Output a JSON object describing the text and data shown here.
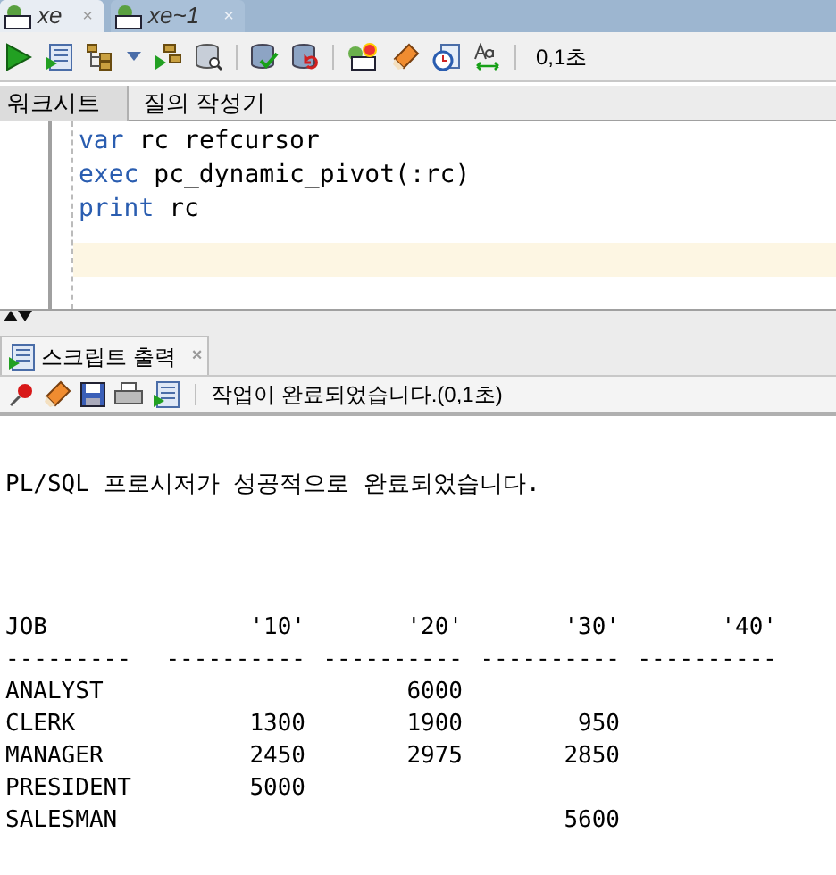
{
  "file_tabs": [
    {
      "label": "xe",
      "selected": true,
      "close": "×"
    },
    {
      "label": "xe~1",
      "selected": false,
      "close": "×"
    }
  ],
  "toolbar": {
    "elapsed": "0,1초"
  },
  "editor_tabs": [
    {
      "label": "워크시트",
      "selected": true
    },
    {
      "label": "질의 작성기",
      "selected": false
    }
  ],
  "code_lines": [
    [
      {
        "kind": "keyword",
        "text": "var"
      },
      {
        "kind": "plain",
        "text": " rc refcursor"
      }
    ],
    [
      {
        "kind": "keyword",
        "text": "exec"
      },
      {
        "kind": "plain",
        "text": " pc_dynamic_pivot(:rc)"
      }
    ],
    [
      {
        "kind": "keyword",
        "text": "print"
      },
      {
        "kind": "plain",
        "text": " rc"
      }
    ]
  ],
  "output_tab": {
    "label": "스크립트 출력",
    "close": "×"
  },
  "output_status": "작업이 완료되었습니다.(0,1초)",
  "output": {
    "message": "PL/SQL 프로시저가 성공적으로 완료되었습니다.",
    "columns": [
      "JOB",
      "'10'",
      "'20'",
      "'30'",
      "'40'"
    ],
    "separators": [
      "---------",
      "----------",
      "----------",
      "----------",
      "----------"
    ],
    "rows": [
      [
        "ANALYST",
        "",
        "6000",
        "",
        ""
      ],
      [
        "CLERK",
        "1300",
        "1900",
        "950",
        ""
      ],
      [
        "MANAGER",
        "2450",
        "2975",
        "2850",
        ""
      ],
      [
        "PRESIDENT",
        "5000",
        "",
        "",
        ""
      ],
      [
        "SALESMAN",
        "",
        "",
        "5600",
        ""
      ]
    ]
  }
}
